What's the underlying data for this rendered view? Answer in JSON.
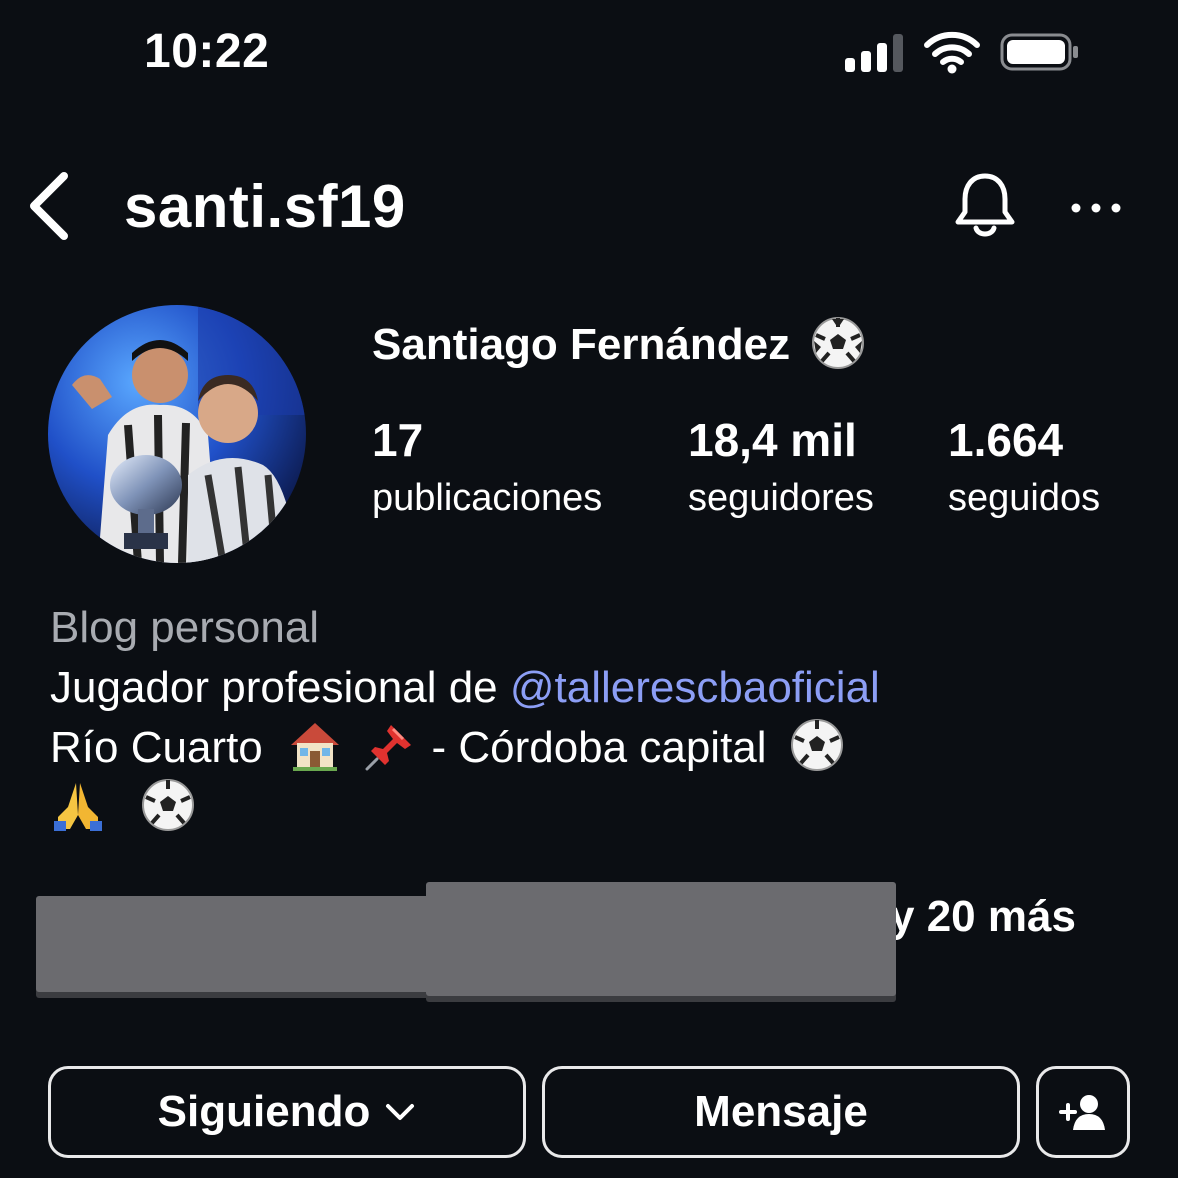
{
  "status_bar": {
    "time": "10:22"
  },
  "header": {
    "username": "santi.sf19",
    "icons": [
      "back-chevron-icon",
      "bell-icon",
      "more-dots-icon"
    ]
  },
  "profile": {
    "full_name": "Santiago Fernández",
    "stats": [
      {
        "count": "17",
        "label": "publicaciones"
      },
      {
        "count": "18,4 mil",
        "label": "seguidores"
      },
      {
        "count": "1.664",
        "label": "seguidos"
      }
    ]
  },
  "bio": {
    "category": "Blog personal",
    "line1_prefix": "Jugador profesional de ",
    "mention": "@tallerescbaoficial",
    "line2_start": "Río Cuarto",
    "line2_end": " - Córdoba capital",
    "emojis": [
      "soccer-ball",
      "house",
      "pushpin",
      "folded-hands"
    ]
  },
  "followed_by": {
    "text": "y 20 más"
  },
  "actions": {
    "following_label": "Siguiendo",
    "message_label": "Mensaje"
  },
  "colors": {
    "background": "#0b0e13",
    "mention": "#8c9ef5",
    "secondary_text": "#a8abb1",
    "redaction": "#6b6b6f"
  }
}
